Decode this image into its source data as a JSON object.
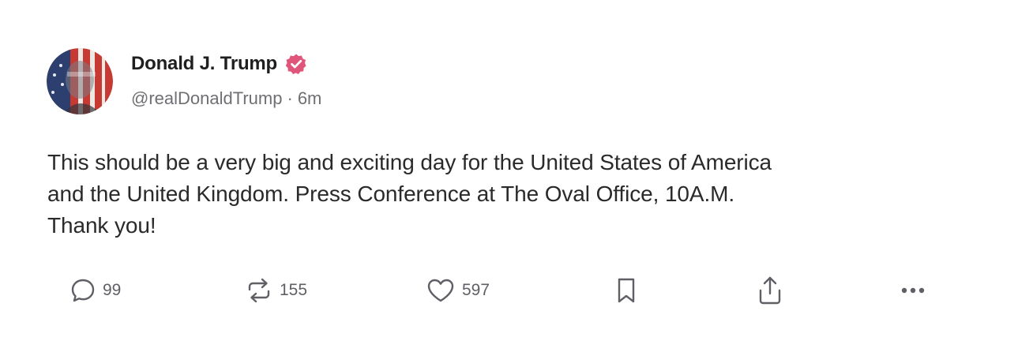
{
  "post": {
    "author": {
      "display_name": "Donald J. Trump",
      "handle": "@realDonaldTrump",
      "verified": true,
      "verified_color": "#e0567a"
    },
    "separator": "·",
    "time_ago": "6m",
    "text": "This should be a very big and exciting day for the United States of America\nand the United Kingdom. Press Conference at The Oval Office, 10A.M.\nThank you!",
    "actions": {
      "replies": {
        "icon": "reply-icon",
        "count": "99"
      },
      "reposts": {
        "icon": "repost-icon",
        "count": "155"
      },
      "likes": {
        "icon": "heart-icon",
        "count": "597"
      },
      "bookmark": {
        "icon": "bookmark-icon"
      },
      "share": {
        "icon": "share-icon"
      },
      "more": {
        "icon": "more-icon"
      }
    }
  }
}
